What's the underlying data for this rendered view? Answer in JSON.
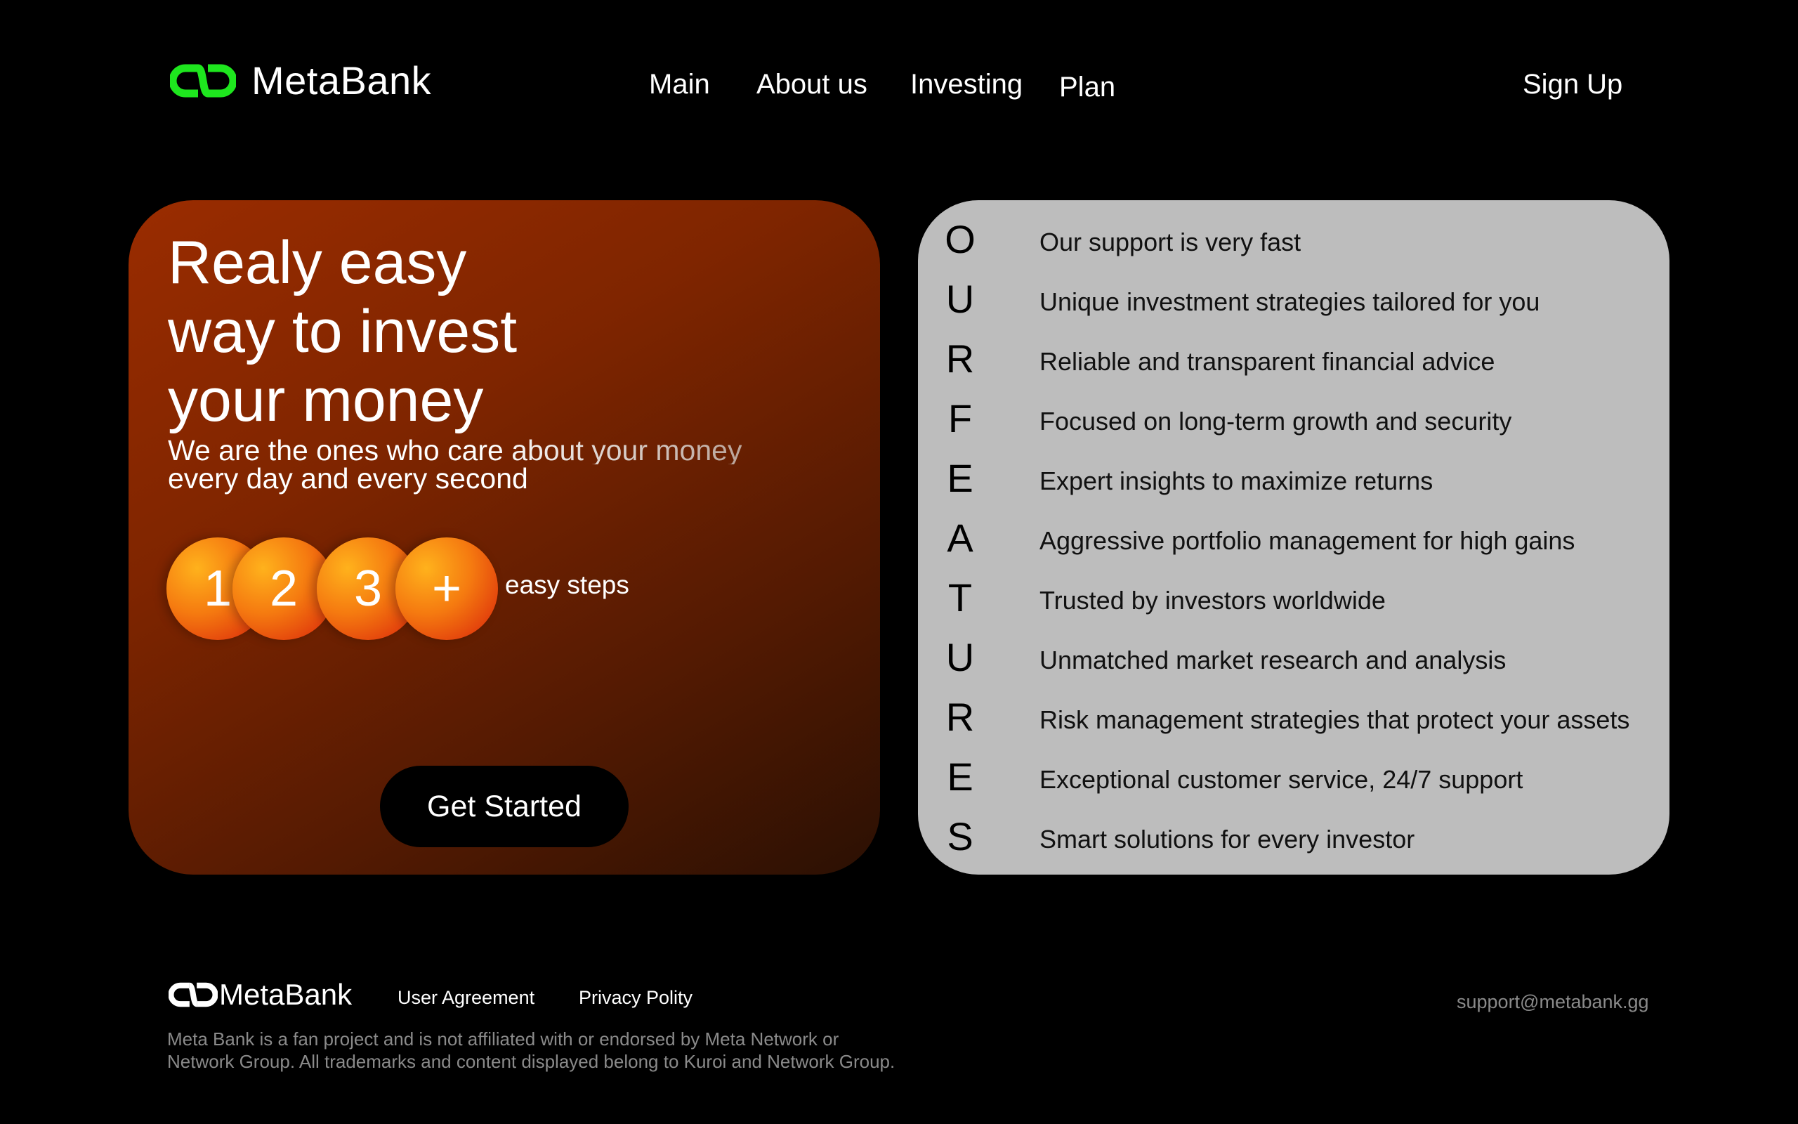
{
  "brand": {
    "name": "MetaBank",
    "accent_color": "#1ee61e"
  },
  "nav": {
    "main": "Main",
    "about": "About us",
    "investing": "Investing",
    "plan": "Plan",
    "signup": "Sign Up"
  },
  "hero": {
    "title_lines": [
      "Realy easy",
      "way to invest",
      "your money"
    ],
    "subtitle_lines": [
      "We are the ones who care about your money",
      "every day and every second"
    ],
    "steps": [
      "1",
      "2",
      "3",
      "+"
    ],
    "steps_label": "easy steps",
    "cta": "Get Started",
    "gradient_colors": [
      "#9a2c00",
      "#2b1003"
    ]
  },
  "features": {
    "items": [
      {
        "letter": "O",
        "text": "Our support is very fast"
      },
      {
        "letter": "U",
        "text": "Unique investment strategies tailored for you"
      },
      {
        "letter": "R",
        "text": "Reliable and transparent financial advice"
      },
      {
        "letter": "F",
        "text": "Focused on long-term growth and security"
      },
      {
        "letter": "E",
        "text": "Expert insights to maximize returns"
      },
      {
        "letter": "A",
        "text": "Aggressive portfolio management for high gains"
      },
      {
        "letter": "T",
        "text": "Trusted by investors worldwide"
      },
      {
        "letter": "U",
        "text": "Unmatched market research and analysis"
      },
      {
        "letter": "R",
        "text": "Risk management strategies that protect your assets"
      },
      {
        "letter": "E",
        "text": "Exceptional customer service, 24/7 support"
      },
      {
        "letter": "S",
        "text": "Smart solutions for every investor"
      }
    ]
  },
  "footer": {
    "brand": "MetaBank",
    "user_agreement": "User Agreement",
    "privacy": "Privacy Polity",
    "email": "support@metabank.gg",
    "disclaimer_lines": [
      "Meta Bank is a fan project and is not affiliated with or endorsed by Meta Network or",
      "Network Group. All trademarks and content displayed belong to Kuroi and Network Group."
    ]
  }
}
